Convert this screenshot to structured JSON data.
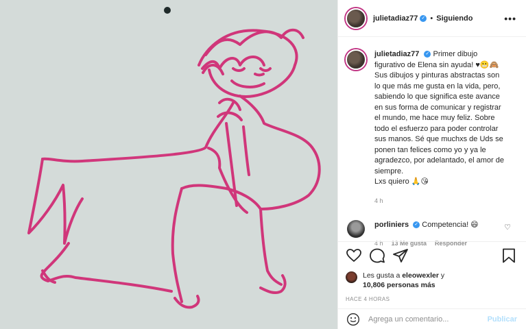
{
  "post": {
    "username": "julietadiaz77",
    "follow_status": "Siguiendo",
    "more_icon": "more-horizontal-icon",
    "caption_lines": [
      "Primer dibujo",
      "figurativo de Elena sin ayuda! ♥😬🙈",
      "Sus dibujos y pinturas abstractas son",
      "lo que más me gusta en la vida, pero,",
      "sabiendo lo que significa este avance",
      "en sus forma de comunicar y registrar",
      "el mundo, me hace muy feliz. Sobre",
      "todo el esfuerzo para poder controlar",
      "sus manos. Sé que muchxs de Uds se",
      "ponen tan felices como yo y ya le",
      "agradezco, por adelantado, el amor de",
      "siempre.",
      "Lxs quiero 🙏😘"
    ],
    "caption_time": "4 h",
    "comment": {
      "username": "porliniers",
      "text": "Competencia! 😄",
      "time": "4 h",
      "likes": "13 Me gusta",
      "reply": "Responder"
    },
    "likes": {
      "prefix": "Les gusta a ",
      "user": "eleowexler",
      "middle": " y",
      "count": "10,806 personas más"
    },
    "posted": "HACE 4 HORAS",
    "comment_placeholder": "Agrega un comentario...",
    "publish_label": "Publicar"
  },
  "colors": {
    "ink": "#d0206e",
    "background": "#d4dbd9",
    "verified": "#3897f0",
    "publish": "#b2dffc"
  }
}
